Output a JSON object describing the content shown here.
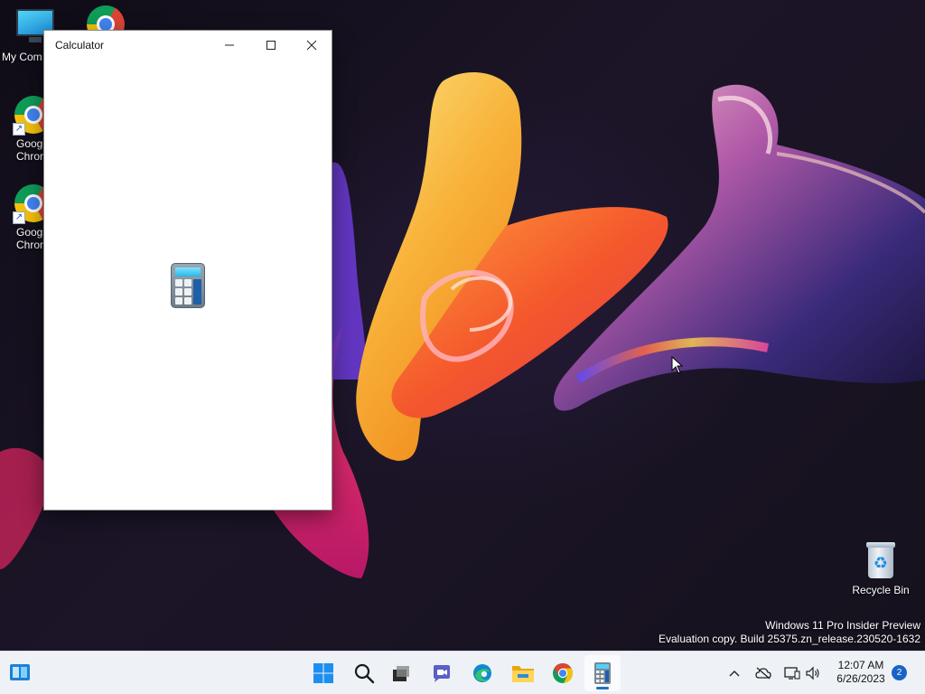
{
  "desktop": {
    "icons": [
      {
        "label": "My Com",
        "icon": "monitor-icon"
      },
      {
        "label": "",
        "icon": "chrome-icon"
      },
      {
        "label": "Goog\nChron",
        "line1": "Goog",
        "line2": "Chron",
        "icon": "chrome-icon"
      },
      {
        "label": "Goog\nChron",
        "line1": "Goog",
        "line2": "Chron",
        "icon": "chrome-icon"
      }
    ],
    "recycle_bin": {
      "label": "Recycle Bin",
      "icon": "recycle-bin-icon"
    }
  },
  "window": {
    "title": "Calculator",
    "controls": {
      "minimize": "minimize-icon",
      "maximize": "maximize-icon",
      "close": "close-icon"
    },
    "splash_icon": "calculator-icon"
  },
  "watermark": {
    "line1": "Windows 11 Pro Insider Preview",
    "line2": "Evaluation copy. Build 25375.zn_release.230520-1632"
  },
  "taskbar": {
    "apps": [
      {
        "name": "start",
        "icon": "windows-logo-icon"
      },
      {
        "name": "search",
        "icon": "search-icon"
      },
      {
        "name": "task-view",
        "icon": "task-view-icon"
      },
      {
        "name": "chat",
        "icon": "chat-icon"
      },
      {
        "name": "edge",
        "icon": "edge-icon"
      },
      {
        "name": "file-explorer",
        "icon": "folder-icon"
      },
      {
        "name": "chrome",
        "icon": "chrome-icon"
      },
      {
        "name": "calculator",
        "icon": "calculator-icon",
        "active": true
      }
    ],
    "tray": {
      "icons": [
        "chevron-up-icon",
        "cloud-offline-icon",
        "network-icon",
        "volume-icon"
      ],
      "time": "12:07 AM",
      "date": "6/26/2023",
      "notification_count": "2"
    }
  },
  "colors": {
    "taskbar_bg": "#eef2f7",
    "accent": "#1a73c8",
    "window_bg": "#ffffff"
  }
}
